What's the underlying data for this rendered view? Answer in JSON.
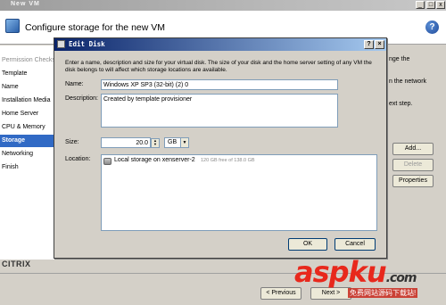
{
  "window": {
    "title": "New VM",
    "header_title": "Configure storage for the new VM",
    "help_label": "?"
  },
  "nav": {
    "items": [
      {
        "label": "Permission Checks",
        "state": "muted"
      },
      {
        "label": "Template",
        "state": "normal"
      },
      {
        "label": "Name",
        "state": "normal"
      },
      {
        "label": "Installation Media",
        "state": "normal"
      },
      {
        "label": "Home Server",
        "state": "normal"
      },
      {
        "label": "CPU & Memory",
        "state": "normal"
      },
      {
        "label": "Storage",
        "state": "active"
      },
      {
        "label": "Networking",
        "state": "normal"
      },
      {
        "label": "Finish",
        "state": "normal"
      }
    ]
  },
  "background": {
    "right_text_1": "nge the",
    "right_text_2": "n the network",
    "right_text_3": "ext step.",
    "add_button": "Add...",
    "delete_button": "Delete",
    "properties_button": "Properties",
    "logo_text": "CITRIX",
    "previous_button": "< Previous",
    "next_button": "Next >"
  },
  "dialog": {
    "title": "Edit Disk",
    "help_btn": "?",
    "close_btn": "×",
    "intro": "Enter a name, description and size for your virtual disk. The size of your disk and the home server setting of any VM the disk belongs to will affect which storage locations are available.",
    "name_label": "Name:",
    "name_value": "Windows XP SP3 (32-bit) (2) 0",
    "description_label": "Description:",
    "description_value": "Created by template provisioner",
    "size_label": "Size:",
    "size_value": "20.0",
    "size_unit": "GB",
    "location_label": "Location:",
    "location_name": "Local storage on xenserver-2",
    "location_free": "120 GB free of 138.0 GB",
    "ok_button": "OK",
    "cancel_button": "Cancel"
  },
  "watermark": {
    "brand": "aspku",
    "domain": ".com",
    "subtitle": "免费网站源码下载站!"
  }
}
